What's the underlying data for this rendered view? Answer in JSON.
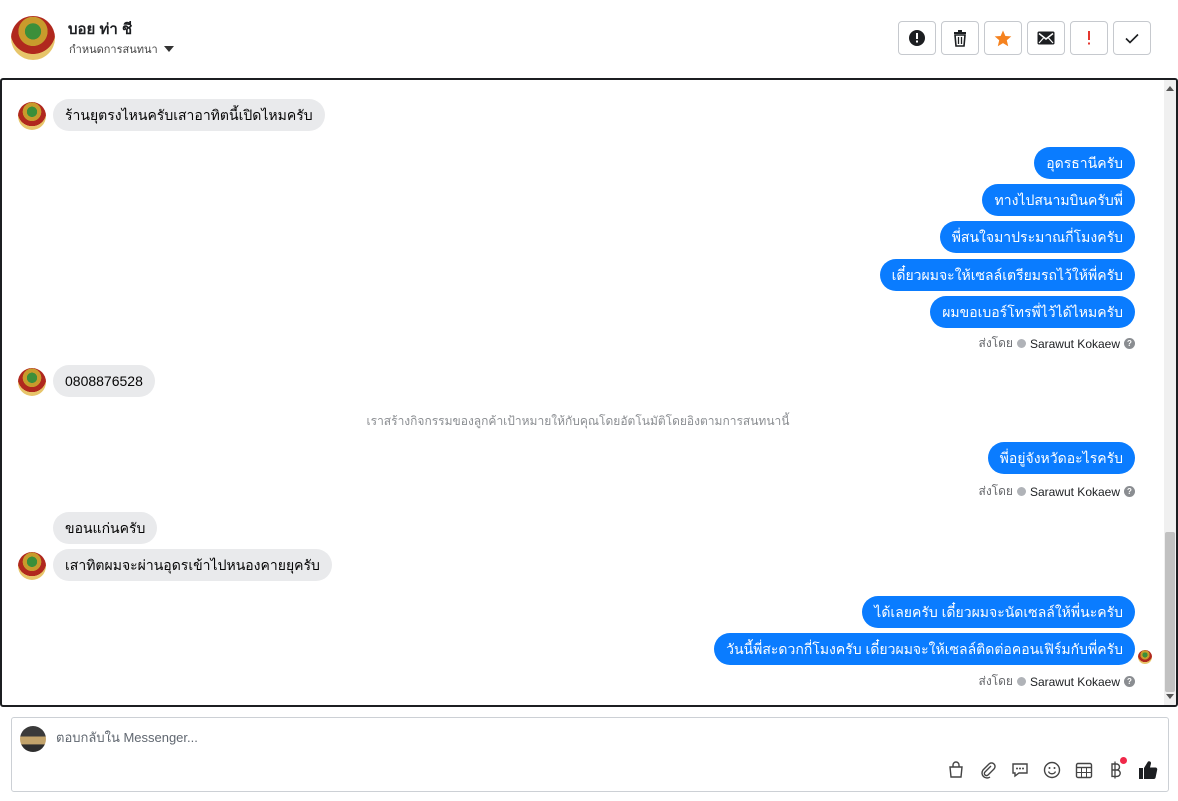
{
  "header": {
    "contact_name": "บอย ท่า ชี",
    "assign_label": "กำหนดการสนทนา"
  },
  "toolbar": {
    "buttons": [
      {
        "name": "spam-alert-button",
        "icon": "alert-circle-icon"
      },
      {
        "name": "delete-button",
        "icon": "trash-icon"
      },
      {
        "name": "star-button",
        "icon": "star-icon",
        "color": "#f5821f"
      },
      {
        "name": "mark-unread-button",
        "icon": "envelope-icon"
      },
      {
        "name": "follow-up-button",
        "icon": "exclamation-icon",
        "color": "#e4372f"
      },
      {
        "name": "mark-done-button",
        "icon": "check-icon"
      }
    ]
  },
  "messages": {
    "m1": "ร้านยุตรงไหนครับเสาอาทิตนี้เปิดไหมครับ",
    "o1": "อุดรธานีครับ",
    "o2": "ทางไปสนามบินครับพี่",
    "o3": "พี่สนใจมาประมาณกี่โมงครับ",
    "o4": "เดี๋ยวผมจะให้เซลล์เตรียมรถไว้ให้พี่ครับ",
    "o5": "ผมขอเบอร์โทรพี่ไว้ได้ไหมครับ",
    "m2": "0808876528",
    "system_note": "เราสร้างกิจกรรมของลูกค้าเป้าหมายให้กับคุณโดยอัตโนมัติโดยอิงตามการสนทนานี้",
    "o6": "พี่อยู่จังหวัดอะไรครับ",
    "m3": "ขอนแก่นครับ",
    "m4": "เสาทิตผมจะผ่านอุดรเข้าไปหนองคายยุครับ",
    "o7": "ได้เลยครับ เดี๋ยวผมจะนัดเซลล์ให้พี่นะครับ",
    "o8": "วันนี้พี่สะดวกกี่โมงครับ เดี๋ยวผมจะให้เซลล์ติดต่อคอนเฟิร์มกับพี่ครับ"
  },
  "sent_by": {
    "prefix": "ส่งโดย",
    "name": "Sarawut Kokaew"
  },
  "composer": {
    "placeholder": "ตอบกลับใน Messenger...",
    "tools": [
      "bag-icon",
      "paperclip-icon",
      "saved-reply-icon",
      "emoji-icon",
      "calendar-icon",
      "baht-payment-icon",
      "like-icon"
    ]
  },
  "colors": {
    "outgoing_bubble": "#0a7cff",
    "incoming_bubble": "#e9eaec",
    "star": "#f5821f",
    "alert": "#e4372f"
  }
}
